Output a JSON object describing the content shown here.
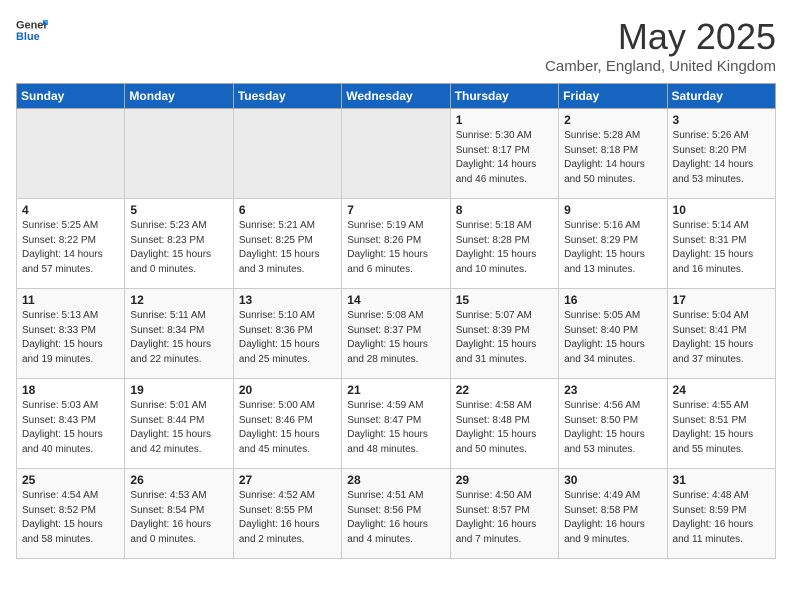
{
  "header": {
    "logo_general": "General",
    "logo_blue": "Blue",
    "title": "May 2025",
    "subtitle": "Camber, England, United Kingdom"
  },
  "days_of_week": [
    "Sunday",
    "Monday",
    "Tuesday",
    "Wednesday",
    "Thursday",
    "Friday",
    "Saturday"
  ],
  "weeks": [
    [
      {
        "day": "",
        "info": ""
      },
      {
        "day": "",
        "info": ""
      },
      {
        "day": "",
        "info": ""
      },
      {
        "day": "",
        "info": ""
      },
      {
        "day": "1",
        "info": "Sunrise: 5:30 AM\nSunset: 8:17 PM\nDaylight: 14 hours\nand 46 minutes."
      },
      {
        "day": "2",
        "info": "Sunrise: 5:28 AM\nSunset: 8:18 PM\nDaylight: 14 hours\nand 50 minutes."
      },
      {
        "day": "3",
        "info": "Sunrise: 5:26 AM\nSunset: 8:20 PM\nDaylight: 14 hours\nand 53 minutes."
      }
    ],
    [
      {
        "day": "4",
        "info": "Sunrise: 5:25 AM\nSunset: 8:22 PM\nDaylight: 14 hours\nand 57 minutes."
      },
      {
        "day": "5",
        "info": "Sunrise: 5:23 AM\nSunset: 8:23 PM\nDaylight: 15 hours\nand 0 minutes."
      },
      {
        "day": "6",
        "info": "Sunrise: 5:21 AM\nSunset: 8:25 PM\nDaylight: 15 hours\nand 3 minutes."
      },
      {
        "day": "7",
        "info": "Sunrise: 5:19 AM\nSunset: 8:26 PM\nDaylight: 15 hours\nand 6 minutes."
      },
      {
        "day": "8",
        "info": "Sunrise: 5:18 AM\nSunset: 8:28 PM\nDaylight: 15 hours\nand 10 minutes."
      },
      {
        "day": "9",
        "info": "Sunrise: 5:16 AM\nSunset: 8:29 PM\nDaylight: 15 hours\nand 13 minutes."
      },
      {
        "day": "10",
        "info": "Sunrise: 5:14 AM\nSunset: 8:31 PM\nDaylight: 15 hours\nand 16 minutes."
      }
    ],
    [
      {
        "day": "11",
        "info": "Sunrise: 5:13 AM\nSunset: 8:33 PM\nDaylight: 15 hours\nand 19 minutes."
      },
      {
        "day": "12",
        "info": "Sunrise: 5:11 AM\nSunset: 8:34 PM\nDaylight: 15 hours\nand 22 minutes."
      },
      {
        "day": "13",
        "info": "Sunrise: 5:10 AM\nSunset: 8:36 PM\nDaylight: 15 hours\nand 25 minutes."
      },
      {
        "day": "14",
        "info": "Sunrise: 5:08 AM\nSunset: 8:37 PM\nDaylight: 15 hours\nand 28 minutes."
      },
      {
        "day": "15",
        "info": "Sunrise: 5:07 AM\nSunset: 8:39 PM\nDaylight: 15 hours\nand 31 minutes."
      },
      {
        "day": "16",
        "info": "Sunrise: 5:05 AM\nSunset: 8:40 PM\nDaylight: 15 hours\nand 34 minutes."
      },
      {
        "day": "17",
        "info": "Sunrise: 5:04 AM\nSunset: 8:41 PM\nDaylight: 15 hours\nand 37 minutes."
      }
    ],
    [
      {
        "day": "18",
        "info": "Sunrise: 5:03 AM\nSunset: 8:43 PM\nDaylight: 15 hours\nand 40 minutes."
      },
      {
        "day": "19",
        "info": "Sunrise: 5:01 AM\nSunset: 8:44 PM\nDaylight: 15 hours\nand 42 minutes."
      },
      {
        "day": "20",
        "info": "Sunrise: 5:00 AM\nSunset: 8:46 PM\nDaylight: 15 hours\nand 45 minutes."
      },
      {
        "day": "21",
        "info": "Sunrise: 4:59 AM\nSunset: 8:47 PM\nDaylight: 15 hours\nand 48 minutes."
      },
      {
        "day": "22",
        "info": "Sunrise: 4:58 AM\nSunset: 8:48 PM\nDaylight: 15 hours\nand 50 minutes."
      },
      {
        "day": "23",
        "info": "Sunrise: 4:56 AM\nSunset: 8:50 PM\nDaylight: 15 hours\nand 53 minutes."
      },
      {
        "day": "24",
        "info": "Sunrise: 4:55 AM\nSunset: 8:51 PM\nDaylight: 15 hours\nand 55 minutes."
      }
    ],
    [
      {
        "day": "25",
        "info": "Sunrise: 4:54 AM\nSunset: 8:52 PM\nDaylight: 15 hours\nand 58 minutes."
      },
      {
        "day": "26",
        "info": "Sunrise: 4:53 AM\nSunset: 8:54 PM\nDaylight: 16 hours\nand 0 minutes."
      },
      {
        "day": "27",
        "info": "Sunrise: 4:52 AM\nSunset: 8:55 PM\nDaylight: 16 hours\nand 2 minutes."
      },
      {
        "day": "28",
        "info": "Sunrise: 4:51 AM\nSunset: 8:56 PM\nDaylight: 16 hours\nand 4 minutes."
      },
      {
        "day": "29",
        "info": "Sunrise: 4:50 AM\nSunset: 8:57 PM\nDaylight: 16 hours\nand 7 minutes."
      },
      {
        "day": "30",
        "info": "Sunrise: 4:49 AM\nSunset: 8:58 PM\nDaylight: 16 hours\nand 9 minutes."
      },
      {
        "day": "31",
        "info": "Sunrise: 4:48 AM\nSunset: 8:59 PM\nDaylight: 16 hours\nand 11 minutes."
      }
    ]
  ]
}
